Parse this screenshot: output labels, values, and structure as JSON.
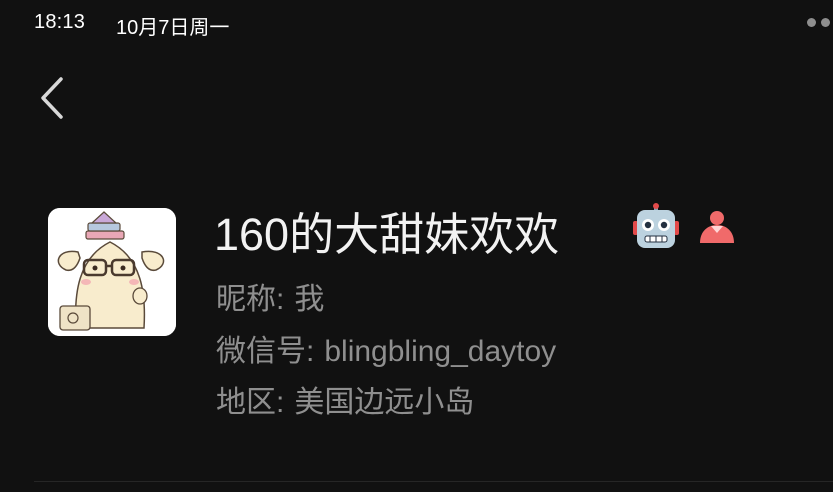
{
  "status_bar": {
    "time": "18:13",
    "date": "10月7日周一"
  },
  "profile": {
    "display_name": "160的大甜妹欢欢",
    "name_emoji_icon": "robot-face-icon",
    "gender_icon": "female-icon",
    "gender_color": "#f06a6a",
    "avatar_icon": "cartoon-dog-with-glasses-avatar",
    "nickname_label": "昵称:",
    "nickname_value": "我",
    "wechat_id_label": "微信号:",
    "wechat_id_value": "blingbling_daytoy",
    "region_label": "地区:",
    "region_value": "美国边远小岛"
  },
  "colors": {
    "background": "#111111",
    "primary_text": "#f2f2f2",
    "secondary_text": "#8f8f8f"
  }
}
